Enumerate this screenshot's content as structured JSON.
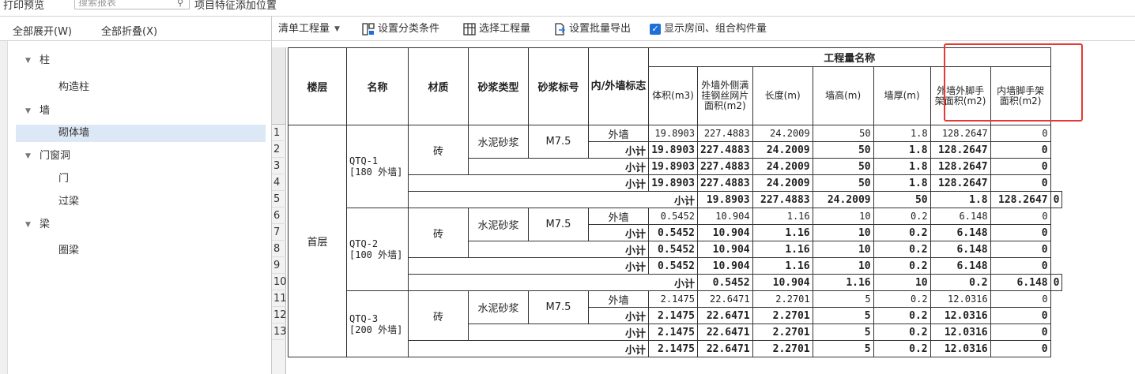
{
  "topbar": {
    "preview_label": "打印预览",
    "search_placeholder": "搜索报表",
    "match_label": "项目特征添加位置"
  },
  "left_toolbar": {
    "expand_all": "全部展开(W)",
    "collapse_all": "全部折叠(X)"
  },
  "tree": {
    "items": [
      {
        "label": "柱",
        "level": 0
      },
      {
        "label": "构造柱",
        "level": 1
      },
      {
        "label": "墙",
        "level": 0
      },
      {
        "label": "砌体墙",
        "level": 1,
        "selected": true
      },
      {
        "label": "门窗洞",
        "level": 0
      },
      {
        "label": "门",
        "level": 1
      },
      {
        "label": "过梁",
        "level": 1
      },
      {
        "label": "梁",
        "level": 0
      },
      {
        "label": "圈梁",
        "level": 1
      }
    ]
  },
  "right_toolbar": {
    "quantity_type": "清单工程量",
    "set_category": "设置分类条件",
    "select_quantity": "选择工程量",
    "batch_export": "设置批量导出",
    "show_rooms": "显示房间、组合构件量"
  },
  "table": {
    "group_header": "工程量名称",
    "headers": {
      "floor": "楼层",
      "name": "名称",
      "material": "材质",
      "mortar_type": "砂浆类型",
      "mortar_grade": "砂浆标号",
      "wall_flag": "内/外墙标志",
      "volume": "体积(m3)",
      "mesh_area": "外墙外侧满挂钢丝网片面积(m2)",
      "length": "长度(m)",
      "height": "墙高(m)",
      "thickness": "墙厚(m)",
      "ext_scaffold": "外墙外脚手架面积(m2)",
      "int_scaffold": "内墙脚手架面积(m2)"
    },
    "floor": "首层",
    "subtotal": "小计",
    "row_numbers": [
      "1",
      "2",
      "3",
      "4",
      "5",
      "6",
      "7",
      "8",
      "9",
      "10",
      "11",
      "12",
      "13"
    ],
    "groups": [
      {
        "name": "QTQ-1 [180 外墙]",
        "material": "砖",
        "mortar_type": "水泥砂浆",
        "mortar_grade": "M7.5",
        "wall_flag": "外墙",
        "values": [
          "19.8903",
          "227.4883",
          "24.2009",
          "50",
          "1.8",
          "128.2647",
          "0"
        ]
      },
      {
        "name": "QTQ-2 [100 外墙]",
        "material": "砖",
        "mortar_type": "水泥砂浆",
        "mortar_grade": "M7.5",
        "wall_flag": "外墙",
        "values": [
          "0.5452",
          "10.904",
          "1.16",
          "10",
          "0.2",
          "6.148",
          "0"
        ]
      },
      {
        "name": "QTQ-3 [200 外墙]",
        "material": "砖",
        "mortar_type": "水泥砂浆",
        "mortar_grade": "M7.5",
        "wall_flag": "外墙",
        "values": [
          "2.1475",
          "22.6471",
          "2.2701",
          "5",
          "0.2",
          "12.0316",
          "0"
        ]
      }
    ]
  },
  "colors": {
    "highlight": "#e53935",
    "checkbox": "#1e6fd9",
    "selected_row": "#dce8f5"
  }
}
